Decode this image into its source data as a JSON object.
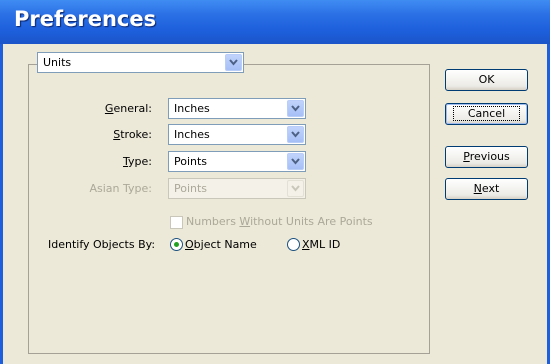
{
  "window": {
    "title": "Preferences"
  },
  "section_select": {
    "value": "Units"
  },
  "fields": {
    "general": {
      "label_pre": "",
      "label_key": "G",
      "label_post": "eneral:",
      "value": "Inches"
    },
    "stroke": {
      "label_pre": "",
      "label_key": "S",
      "label_post": "troke:",
      "value": "Inches"
    },
    "type": {
      "label_pre": "",
      "label_key": "T",
      "label_post": "ype:",
      "value": "Points"
    },
    "asian_type": {
      "label": "Asian Type:",
      "value": "Points"
    }
  },
  "numbers_checkbox": {
    "pre": "Numbers ",
    "key": "W",
    "post": "ithout Units Are Points",
    "checked": false
  },
  "identify": {
    "label": "Identify Objects By:",
    "option_object": {
      "pre": "",
      "key": "O",
      "post": "bject Name",
      "selected": true
    },
    "option_xml": {
      "pre": "",
      "key": "X",
      "post": "ML ID",
      "selected": false
    }
  },
  "buttons": {
    "ok": "OK",
    "cancel": "Cancel",
    "previous": {
      "pre": "",
      "key": "P",
      "post": "revious"
    },
    "next": {
      "pre": "",
      "key": "N",
      "post": "ext"
    }
  },
  "colors": {
    "title_bar": "#1d5fdc",
    "face": "#ece9d8",
    "radio_dot": "#21a121"
  }
}
